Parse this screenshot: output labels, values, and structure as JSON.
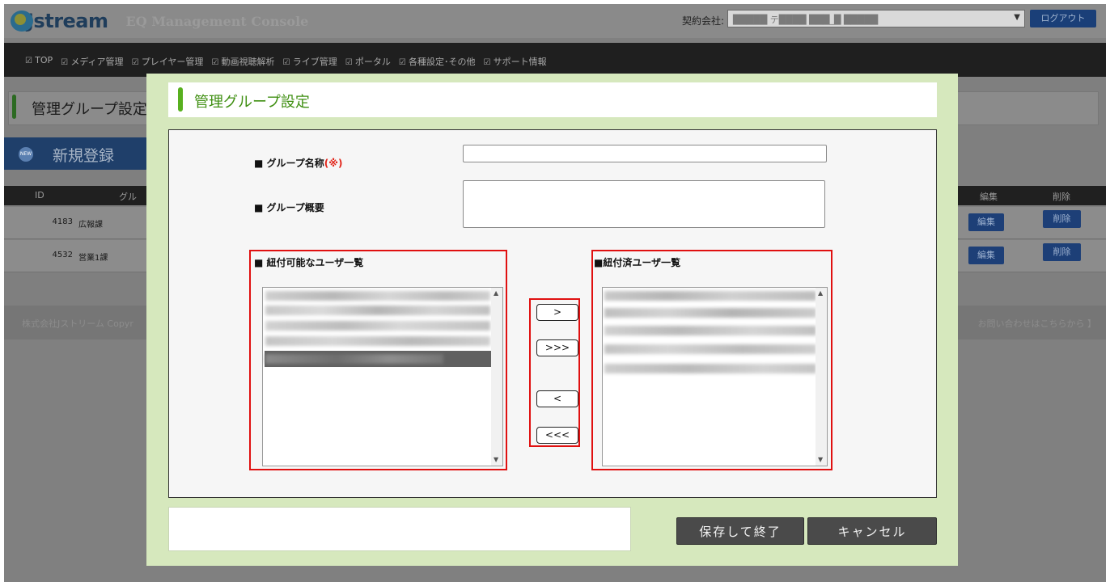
{
  "header": {
    "brand": "Jstream",
    "app_title": "EQ Management Console",
    "contract_label": "契約会社:",
    "contract_value": "█████ テ████ ███_█ █████",
    "logout_label": "ログアウト"
  },
  "nav": {
    "items": [
      "TOP",
      "メディア管理",
      "プレイヤー管理",
      "動画視聴解析",
      "ライブ管理",
      "ポータル",
      "各種設定･その他",
      "サポート情報"
    ]
  },
  "page": {
    "title": "管理グループ設定",
    "new_button": "新規登録",
    "new_badge": "NEW",
    "table": {
      "headers": {
        "id": "ID",
        "group": "グル",
        "edit": "編集",
        "delete": "削除"
      },
      "rows": [
        {
          "id": "4183",
          "name": "広報課",
          "edit": "編集",
          "delete": "削除"
        },
        {
          "id": "4532",
          "name": "営業1課",
          "edit": "編集",
          "delete": "削除"
        }
      ]
    },
    "footer": {
      "left": "株式会社Jストリーム  Copyr",
      "right": "お問い合わせはこちらから 】"
    }
  },
  "modal": {
    "title": "管理グループ設定",
    "group_name_label": "■ グループ名称",
    "required_mark": "(※)",
    "group_name_value": "",
    "group_desc_label": "■ グループ概要",
    "group_desc_value": "",
    "available_users_label": "■ 紐付可能なユーザ一覧",
    "linked_users_label": "■紐付済ユーザ一覧",
    "buttons": {
      "add_one": ">",
      "add_all": ">>>",
      "remove_one": "<",
      "remove_all": "<<<",
      "save": "保存して終了",
      "cancel": "キャンセル"
    }
  },
  "colors": {
    "modal_bg": "#d6e8bd",
    "accent_green": "#58b01f",
    "title_green": "#3f8f12",
    "highlight_red": "#e01010",
    "required_red": "#e2261b",
    "dark_button": "#4a4a4a"
  }
}
